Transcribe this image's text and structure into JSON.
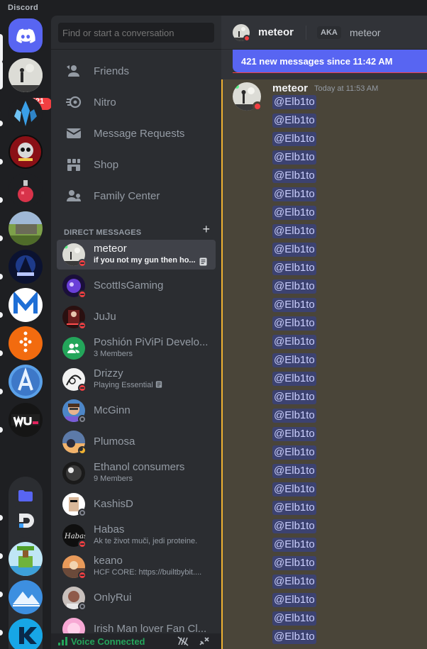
{
  "window": {
    "app_title": "Discord"
  },
  "rail": {
    "home_icon": "discord-logo-icon",
    "mention_badge": "421",
    "servers": [
      {
        "name": "avatar-server",
        "color": "#8a8f87"
      },
      {
        "name": "crystal-server",
        "color": "#3aa0e8"
      },
      {
        "name": "skull-server",
        "color": "#b01e24"
      },
      {
        "name": "potion-server",
        "color": "#7a1f2e"
      },
      {
        "name": "landscape-server",
        "color": "#5f7a3a"
      },
      {
        "name": "ace-server",
        "color": "#1b2a5c"
      },
      {
        "name": "m-server",
        "color": "#1f6fd6"
      },
      {
        "name": "orange-server",
        "color": "#f26b0f"
      },
      {
        "name": "a-server",
        "color": "#3d78c8"
      },
      {
        "name": "wu-server",
        "color": "#151515"
      }
    ],
    "folder_servers": [
      {
        "name": "folder-icon"
      },
      {
        "name": "d-server"
      },
      {
        "name": "island-server"
      },
      {
        "name": "mountain-server"
      },
      {
        "name": "k-server"
      }
    ]
  },
  "sidebar": {
    "search_placeholder": "Find or start a conversation",
    "nav": [
      {
        "label": "Friends",
        "icon": "friends-icon"
      },
      {
        "label": "Nitro",
        "icon": "nitro-icon"
      },
      {
        "label": "Message Requests",
        "icon": "envelope-icon"
      },
      {
        "label": "Shop",
        "icon": "shop-icon"
      },
      {
        "label": "Family Center",
        "icon": "family-icon"
      }
    ],
    "dm_header": "DIRECT MESSAGES",
    "dms": [
      {
        "name": "meteor",
        "sub": "if you not my gun then ho...",
        "status": "dnd",
        "active": true
      },
      {
        "name": "ScottIsGaming",
        "sub": "",
        "status": "dnd"
      },
      {
        "name": "JuJu",
        "sub": "",
        "status": "dnd"
      },
      {
        "name": "Poshión PiViPi Develo...",
        "sub": "3 Members",
        "status": "group"
      },
      {
        "name": "Drizzy",
        "sub": "Playing Essential",
        "status": "dnd"
      },
      {
        "name": "McGinn",
        "sub": "",
        "status": "off"
      },
      {
        "name": "Plumosa",
        "sub": "",
        "status": "idle"
      },
      {
        "name": "Ethanol consumers",
        "sub": "9 Members",
        "status": "group"
      },
      {
        "name": "KashisD",
        "sub": "",
        "status": "off"
      },
      {
        "name": "Habas",
        "sub": "Ak te život muči, jedi proteine.",
        "status": "dnd"
      },
      {
        "name": "keano",
        "sub": "HCF CORE: https://builtbybit....",
        "status": "dnd"
      },
      {
        "name": "OnlyRui",
        "sub": "",
        "status": "off"
      },
      {
        "name": "Irish Man lover Fan Cl...",
        "sub": "",
        "status": "group"
      }
    ]
  },
  "voice": {
    "label": "Voice Connected"
  },
  "chat": {
    "header_name": "meteor",
    "aka_label": "AKA",
    "aka_name": "meteor",
    "new_messages_bar": "421 new messages since 11:42 AM",
    "message": {
      "author": "meteor",
      "timestamp": "Today at 11:53 AM",
      "mention": "@Elb1to",
      "mention_count": 30
    }
  }
}
